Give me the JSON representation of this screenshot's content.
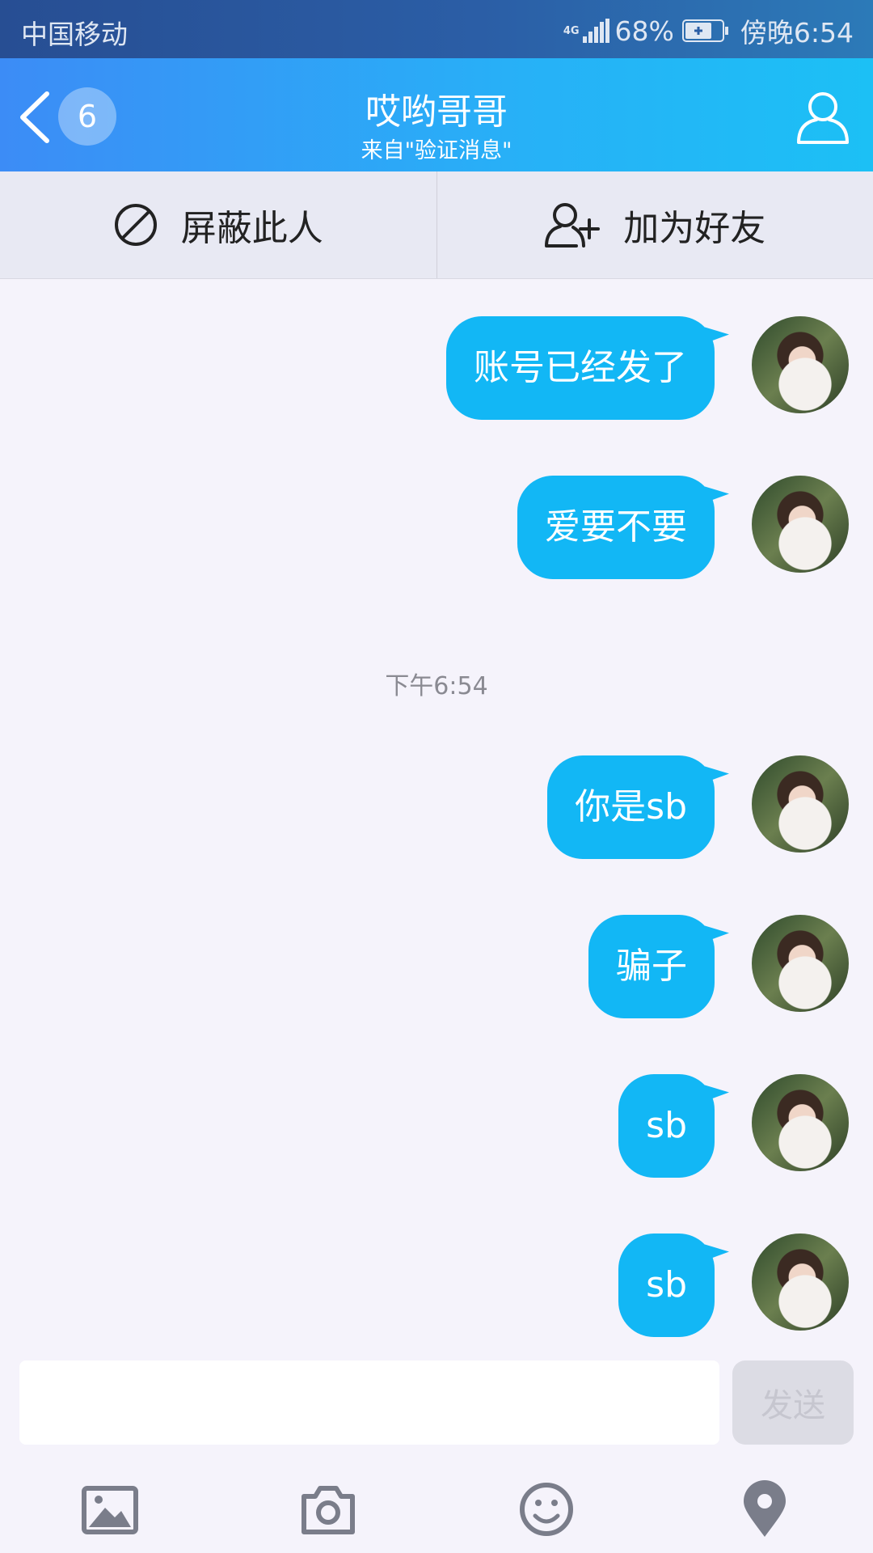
{
  "status_bar": {
    "carrier": "中国移动",
    "network": "4G",
    "battery_percent": "68%",
    "time": "傍晚6:54"
  },
  "header": {
    "unread_count": "6",
    "title": "哎哟哥哥",
    "subtitle": "来自\"验证消息\""
  },
  "actions": {
    "block_label": "屏蔽此人",
    "add_friend_label": "加为好友"
  },
  "messages": [
    {
      "text": "账号已经发了"
    },
    {
      "text": "爱要不要"
    },
    {
      "text": "你是sb"
    },
    {
      "text": "骗子"
    },
    {
      "text": "sb"
    },
    {
      "text": "sb"
    }
  ],
  "timestamp": "下午6:54",
  "input": {
    "value": "",
    "placeholder": "",
    "send_label": "发送"
  },
  "toolbar_icons": [
    "image-icon",
    "camera-icon",
    "emoji-icon",
    "location-icon"
  ],
  "colors": {
    "bubble": "#12b7f5",
    "header_start": "#3c8cf6",
    "header_end": "#1cc0f5"
  }
}
